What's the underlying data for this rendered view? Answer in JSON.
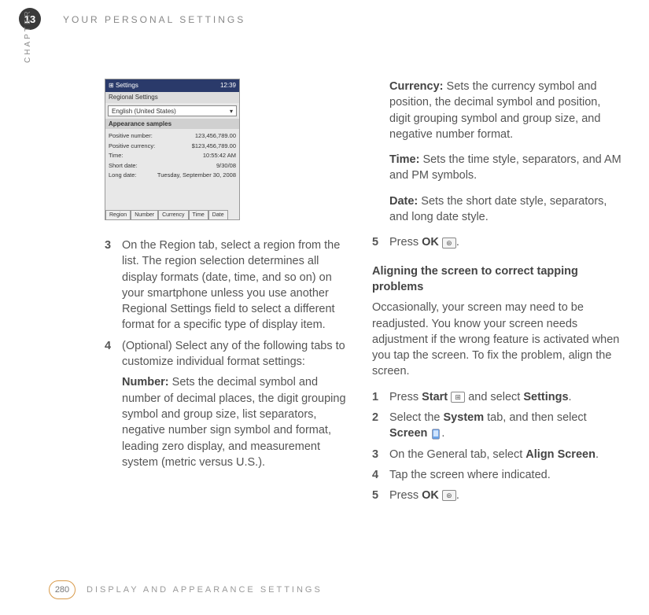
{
  "chapter_number": "13",
  "chapter_label": "CHAPTER",
  "header_title": "YOUR PERSONAL SETTINGS",
  "page_number": "280",
  "footer_title": "DISPLAY AND APPEARANCE SETTINGS",
  "screenshot": {
    "topbar_left": "Settings",
    "topbar_right": "12:39",
    "subbar": "Regional Settings",
    "dropdown_value": "English (United States)",
    "section_label": "Appearance samples",
    "rows": [
      {
        "label": "Positive number:",
        "value": "123,456,789.00"
      },
      {
        "label": "Positive currency:",
        "value": "$123,456,789.00"
      },
      {
        "label": "Time:",
        "value": "10:55:42 AM"
      },
      {
        "label": "Short date:",
        "value": "9/30/08"
      },
      {
        "label": "Long date:",
        "value": "Tuesday, September 30, 2008"
      }
    ],
    "tabs": [
      "Region",
      "Number",
      "Currency",
      "Time",
      "Date"
    ]
  },
  "left": {
    "step3_num": "3",
    "step3": "On the Region tab, select a region from the list. The region selection determines all display formats (date, time, and so on) on your smartphone unless you use another Regional Settings field to select a different format for a specific type of display item.",
    "step4_num": "4",
    "step4": "(Optional) Select any of the following tabs to customize individual format settings:",
    "number_label": "Number:",
    "number_text": " Sets the decimal symbol and number of decimal places, the digit grouping symbol and group size, list separators, negative number sign symbol and format, leading zero display, and measurement system (metric versus U.S.)."
  },
  "right": {
    "currency_label": "Currency:",
    "currency_text": " Sets the currency symbol and position, the decimal symbol and position, digit grouping symbol and group size, and negative number format.",
    "time_label": "Time:",
    "time_text": " Sets the time style, separators, and AM and PM symbols.",
    "date_label": "Date:",
    "date_text": " Sets the short date style, separators, and long date style.",
    "step5_num": "5",
    "step5_a": "Press ",
    "step5_ok": "OK",
    "step5_b": " ",
    "step5_c": ".",
    "heading": "Aligning the screen to correct tapping problems",
    "intro": "Occasionally, your screen may need to be readjusted. You know your screen needs adjustment if the wrong feature is activated when you tap the screen. To fix the problem, align the screen.",
    "a1_num": "1",
    "a1_a": "Press ",
    "a1_start": "Start",
    "a1_b": " ",
    "a1_c": " and select ",
    "a1_settings": "Settings",
    "a1_d": ".",
    "a2_num": "2",
    "a2_a": "Select the ",
    "a2_system": "System",
    "a2_b": " tab, and then select ",
    "a2_screen": "Screen",
    "a2_c": " ",
    "a2_d": ".",
    "a3_num": "3",
    "a3_a": "On the General tab, select ",
    "a3_align": "Align Screen",
    "a3_b": ".",
    "a4_num": "4",
    "a4": "Tap the screen where indicated.",
    "a5_num": "5",
    "a5_a": "Press ",
    "a5_ok": "OK",
    "a5_b": " ",
    "a5_c": "."
  }
}
